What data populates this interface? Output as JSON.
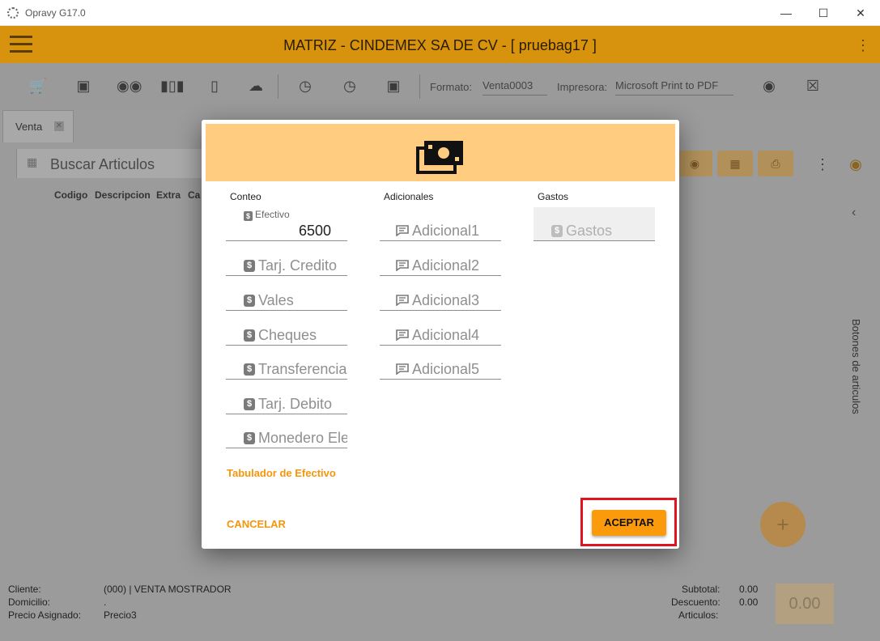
{
  "window": {
    "title": "Opravy G17.0"
  },
  "appbar": {
    "title": "MATRIZ - CINDEMEX SA DE CV - [ pruebag17 ]"
  },
  "toolbar": {
    "formato_label": "Formato:",
    "formato_value": "Venta0003",
    "impresora_label": "Impresora:",
    "impresora_value": "Microsoft Print to PDF"
  },
  "tabs": [
    {
      "label": "Venta"
    }
  ],
  "search": {
    "placeholder": "Buscar Articulos"
  },
  "columns": [
    "Codigo",
    "Descripcion",
    "Extra",
    "Ca"
  ],
  "side_panel": {
    "label": "Botones de articulos"
  },
  "footer": {
    "cliente_label": "Cliente:",
    "cliente_value": "(000) | VENTA MOSTRADOR",
    "domicilio_label": "Domicilio:",
    "domicilio_value": ".",
    "precio_label": "Precio Asignado:",
    "precio_value": "Precio3",
    "subtotal_label": "Subtotal:",
    "subtotal_value": "0.00",
    "descuento_label": "Descuento:",
    "descuento_value": "0.00",
    "articulos_label": "Articulos:",
    "total": "0.00"
  },
  "modal": {
    "columns": {
      "conteo": "Conteo",
      "adicionales": "Adicionales",
      "gastos": "Gastos"
    },
    "conteo_fields": [
      {
        "label": "Efectivo",
        "value": "6500"
      },
      {
        "label": "Tarj. Credito"
      },
      {
        "label": "Vales"
      },
      {
        "label": "Cheques"
      },
      {
        "label": "Transferencia"
      },
      {
        "label": "Tarj. Debito"
      },
      {
        "label": "Monedero Electronico"
      }
    ],
    "adicionales_fields": [
      "Adicional1",
      "Adicional2",
      "Adicional3",
      "Adicional4",
      "Adicional5"
    ],
    "gastos_field": "Gastos",
    "tabulador_link": "Tabulador de Efectivo",
    "cancel_label": "CANCELAR",
    "accept_label": "ACEPTAR",
    "icons": {
      "header": "money-icon",
      "currency": "dollar-icon",
      "note": "comment-icon"
    },
    "colors": {
      "accent": "#fb9a0a",
      "header_bg": "#ffcc80",
      "highlight": "#e0141e"
    }
  }
}
